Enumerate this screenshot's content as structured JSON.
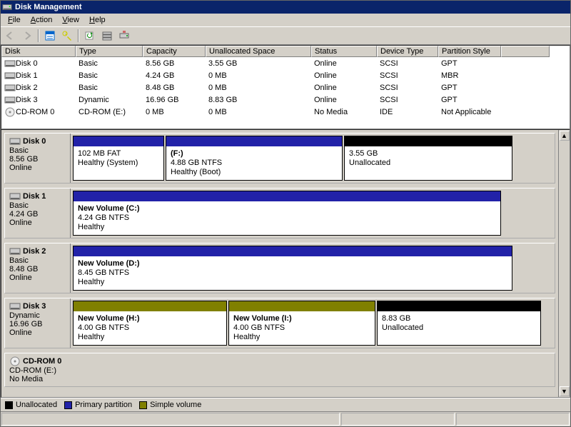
{
  "title": "Disk Management",
  "menu": {
    "file": "File",
    "action": "Action",
    "view": "View",
    "help": "Help"
  },
  "columns": {
    "disk": "Disk",
    "type": "Type",
    "capacity": "Capacity",
    "unalloc": "Unallocated Space",
    "status": "Status",
    "devtype": "Device Type",
    "pstyle": "Partition Style"
  },
  "disks": [
    {
      "name": "Disk 0",
      "type": "Basic",
      "capacity": "8.56 GB",
      "unalloc": "3.55 GB",
      "status": "Online",
      "devtype": "SCSI",
      "pstyle": "GPT"
    },
    {
      "name": "Disk 1",
      "type": "Basic",
      "capacity": "4.24 GB",
      "unalloc": "0 MB",
      "status": "Online",
      "devtype": "SCSI",
      "pstyle": "MBR"
    },
    {
      "name": "Disk 2",
      "type": "Basic",
      "capacity": "8.48 GB",
      "unalloc": "0 MB",
      "status": "Online",
      "devtype": "SCSI",
      "pstyle": "GPT"
    },
    {
      "name": "Disk 3",
      "type": "Dynamic",
      "capacity": "16.96 GB",
      "unalloc": "8.83 GB",
      "status": "Online",
      "devtype": "SCSI",
      "pstyle": "GPT"
    },
    {
      "name": "CD-ROM 0",
      "type": "CD-ROM (E:)",
      "capacity": "0 MB",
      "unalloc": "0 MB",
      "status": "No Media",
      "devtype": "IDE",
      "pstyle": "Not Applicable"
    }
  ],
  "graph": {
    "d0": {
      "head": "Disk 0",
      "sub1": "Basic",
      "sub2": "8.56 GB",
      "sub3": "Online",
      "v0": {
        "l1": "",
        "l2": "102 MB FAT",
        "l3": "Healthy (System)"
      },
      "v1": {
        "l1": " (F:)",
        "l2": "4.88 GB NTFS",
        "l3": "Healthy (Boot)"
      },
      "v2": {
        "l1": "",
        "l2": "3.55 GB",
        "l3": "Unallocated"
      }
    },
    "d1": {
      "head": "Disk 1",
      "sub1": "Basic",
      "sub2": "4.24 GB",
      "sub3": "Online",
      "v0": {
        "l1": "New Volume  (C:)",
        "l2": "4.24 GB NTFS",
        "l3": "Healthy"
      }
    },
    "d2": {
      "head": "Disk 2",
      "sub1": "Basic",
      "sub2": "8.48 GB",
      "sub3": "Online",
      "v0": {
        "l1": "New Volume  (D:)",
        "l2": "8.45 GB NTFS",
        "l3": "Healthy"
      }
    },
    "d3": {
      "head": "Disk 3",
      "sub1": "Dynamic",
      "sub2": "16.96 GB",
      "sub3": "Online",
      "v0": {
        "l1": "New Volume (H:)",
        "l2": "4.00 GB NTFS",
        "l3": "Healthy"
      },
      "v1": {
        "l1": "New Volume (I:)",
        "l2": "4.00 GB NTFS",
        "l3": "Healthy"
      },
      "v2": {
        "l1": "",
        "l2": "8.83 GB",
        "l3": "Unallocated"
      }
    },
    "cd": {
      "head": "CD-ROM 0",
      "sub1": "CD-ROM (E:)",
      "sub2": "",
      "sub3": "No Media"
    }
  },
  "legend": {
    "unalloc": "Unallocated",
    "primary": "Primary partition",
    "simple": "Simple volume"
  },
  "colors": {
    "unalloc": "#000000",
    "primary": "#2222a8",
    "simple": "#808000"
  }
}
